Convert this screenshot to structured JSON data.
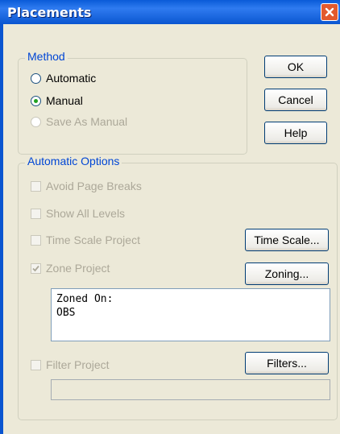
{
  "window": {
    "title": "Placements"
  },
  "method": {
    "label": "Method",
    "options": [
      {
        "label": "Automatic",
        "selected": false,
        "enabled": true
      },
      {
        "label": "Manual",
        "selected": true,
        "enabled": true
      },
      {
        "label": "Save As Manual",
        "selected": false,
        "enabled": false
      }
    ]
  },
  "buttons": {
    "ok": "OK",
    "cancel": "Cancel",
    "help": "Help"
  },
  "automatic_options": {
    "label": "Automatic Options",
    "avoid_page_breaks": {
      "label": "Avoid Page Breaks",
      "checked": false,
      "enabled": false
    },
    "show_all_levels": {
      "label": "Show All Levels",
      "checked": false,
      "enabled": false
    },
    "time_scale_project": {
      "label": "Time Scale Project",
      "checked": false,
      "enabled": false
    },
    "time_scale_button": "Time Scale...",
    "zone_project": {
      "label": "Zone Project",
      "checked": true,
      "enabled": false
    },
    "zoning_button": "Zoning...",
    "zoned_on": {
      "line1": "Zoned On:",
      "line2": "OBS"
    },
    "filter_project": {
      "label": "Filter Project",
      "checked": false,
      "enabled": false
    },
    "filters_button": "Filters...",
    "filter_value": ""
  },
  "colors": {
    "titlebar": "#0a5bd8",
    "close": "#e25a2e",
    "dialog": "#ece9d8",
    "group_label": "#0046d5",
    "disabled_text": "#aca899"
  }
}
